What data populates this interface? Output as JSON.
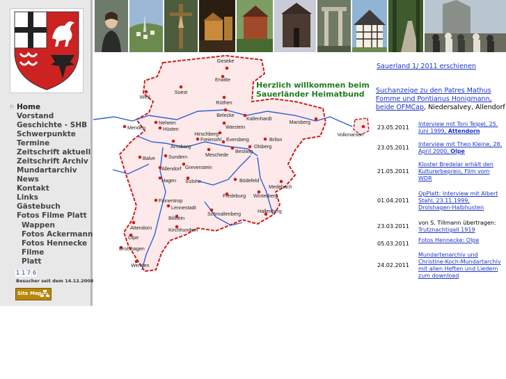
{
  "sidebar": {
    "nav": [
      {
        "label": "Home",
        "sub": false,
        "active": true
      },
      {
        "label": "Vorstand",
        "sub": false
      },
      {
        "label": "Geschichte - SHB",
        "sub": false
      },
      {
        "label": "Schwerpunkte",
        "sub": false
      },
      {
        "label": "Termine",
        "sub": false
      },
      {
        "label": "Zeitschrift aktuell",
        "sub": false
      },
      {
        "label": "Zeitschrift Archiv",
        "sub": false
      },
      {
        "label": "Mundartarchiv",
        "sub": false
      },
      {
        "label": "News",
        "sub": false
      },
      {
        "label": "Kontakt",
        "sub": false
      },
      {
        "label": "Links",
        "sub": false
      },
      {
        "label": "Gästebuch",
        "sub": false
      },
      {
        "label": "Fotos Filme Platt",
        "sub": false
      },
      {
        "label": "Wappen",
        "sub": true
      },
      {
        "label": "Fotos Ackermann",
        "sub": true
      },
      {
        "label": "Fotos Hennecke",
        "sub": true
      },
      {
        "label": "Filme",
        "sub": true
      },
      {
        "label": "Platt",
        "sub": true
      }
    ],
    "counter_digits": [
      "1",
      "1",
      "7",
      "6"
    ],
    "visitor_text": "Besucher seit dem 14.12.2008",
    "sitemap_label": "Site Map"
  },
  "map": {
    "headline_line1": "Herzlich willkommen beim",
    "headline_line2": "Sauerländer Heimatbund",
    "towns": [
      "Geseke",
      "Erwitte",
      "Soest",
      "Werl",
      "Rüthen",
      "Belecke",
      "Kallenhardt",
      "Warstein",
      "Marsberg",
      "Menden",
      "Neheim",
      "Hüsten",
      "Hirschberg",
      "Freienohl",
      "Eversberg",
      "Brilon",
      "Arnsberg",
      "Bestwig",
      "Olsberg",
      "Volkmarsen",
      "Balve",
      "Sundern",
      "Meschede",
      "Allendorf",
      "Grevenstein",
      "Hagen",
      "Eslohe",
      "Bödefeld",
      "Medebach",
      "Fredeburg",
      "Winterberg",
      "Finnentrop",
      "Lennestadt",
      "Schmallenberg",
      "Hallenberg",
      "Bilstein",
      "Kirchhundem",
      "Attendorn",
      "Olpe",
      "Drolshagen",
      "Wenden"
    ]
  },
  "right": {
    "sauerland_link": "Sauerland  1/ 2011  erschienen",
    "search_line1": "Suchanzeige zu den Patres Mathus",
    "search_line2": "Fomme und Pontianus Honigmann,",
    "search_line3_link": "beide OFMCap",
    "search_line3_rest": ", Niedersalvey, Allendorf",
    "news": [
      {
        "date": "23.05.2011",
        "text": "Interview mit Toni Teipel, 25. Juni 1999, ",
        "bold": "Attendorn"
      },
      {
        "date": "23.05.2011",
        "text": "Interview mit Theo Kleine, 28. April 2000, ",
        "bold": "Olpe"
      },
      {
        "date": "21.05.2011",
        "text": "Kloster Bredelar erhält den Kulturerbepreis, Film vom WDR",
        "bold": ""
      },
      {
        "date": "01.04.2011",
        "text": "OpPlatt: Interview mit Albert Stahl, 23.11.1999, Drolshagen-Halbhusten",
        "bold": ""
      },
      {
        "date": "23.03.2011",
        "prefix": "von S. Tillmann übertragen:",
        "text": "Trutznachtigall 1919",
        "bold": ""
      },
      {
        "date": "05.03.2011",
        "text": "Fotos Hennecke: Olpe",
        "bold": ""
      },
      {
        "date": "24.02.2011",
        "text": "Mundartenarchiv  und Christine-Koch-Mundartarchiv mit allen Heften und Liedern zum download",
        "bold": ""
      }
    ]
  },
  "colors": {
    "sidebar_bg": "#e8e8e8",
    "link": "#1a33c9",
    "headline": "#1e7d1e",
    "map_fill": "#fde9e9",
    "map_border": "#d21a1a",
    "river": "#2f5fd6"
  }
}
